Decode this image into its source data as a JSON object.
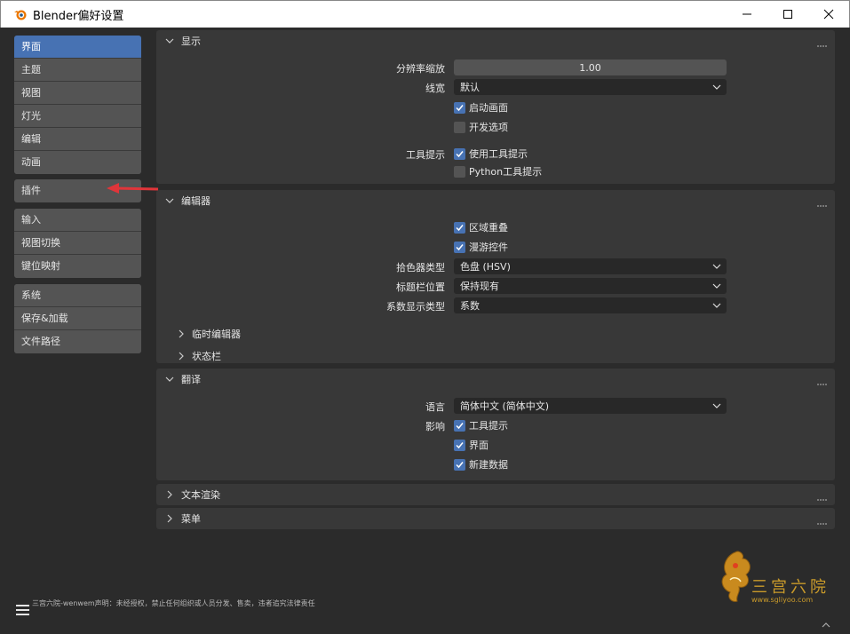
{
  "window": {
    "title": "Blender偏好设置",
    "controls": {
      "minimize": "—",
      "maximize": "☐",
      "close": "✕"
    }
  },
  "sidebar": {
    "groups": [
      {
        "items": [
          {
            "label": "界面",
            "active": true
          },
          {
            "label": "主题"
          },
          {
            "label": "视图"
          },
          {
            "label": "灯光"
          },
          {
            "label": "编辑"
          },
          {
            "label": "动画"
          }
        ]
      },
      {
        "items": [
          {
            "label": "插件"
          }
        ]
      },
      {
        "items": [
          {
            "label": "输入"
          },
          {
            "label": "视图切换"
          },
          {
            "label": "键位映射"
          }
        ]
      },
      {
        "items": [
          {
            "label": "系统"
          },
          {
            "label": "保存&加载"
          },
          {
            "label": "文件路径"
          }
        ]
      }
    ],
    "footer_note": "三宫六院-wenwem声明：未经授权，禁止任何组织或人员分发、售卖，违者追究法律责任"
  },
  "panels": {
    "display": {
      "title": "显示",
      "resolution_scale_label": "分辨率缩放",
      "resolution_scale_value": "1.00",
      "line_width_label": "线宽",
      "line_width_value": "默认",
      "splash_label": "启动画面",
      "splash_checked": true,
      "dev_extras_label": "开发选项",
      "dev_extras_checked": false,
      "tooltips_label": "工具提示",
      "use_tooltips_label": "使用工具提示",
      "use_tooltips_checked": true,
      "python_tooltips_label": "Python工具提示",
      "python_tooltips_checked": false
    },
    "editors": {
      "title": "编辑器",
      "region_overlap_label": "区域重叠",
      "region_overlap_checked": true,
      "navigation_controls_label": "漫游控件",
      "navigation_controls_checked": true,
      "color_picker_label": "拾色器类型",
      "color_picker_value": "色盘 (HSV)",
      "header_position_label": "标题栏位置",
      "header_position_value": "保持现有",
      "factor_display_label": "系数显示类型",
      "factor_display_value": "系数",
      "temp_editors_label": "临时编辑器",
      "status_bar_label": "状态栏"
    },
    "translation": {
      "title": "翻译",
      "language_label": "语言",
      "language_value": "简体中文 (简体中文)",
      "affect_label": "影响",
      "tooltips_label": "工具提示",
      "tooltips_checked": true,
      "interface_label": "界面",
      "interface_checked": true,
      "new_data_label": "新建数据",
      "new_data_checked": true
    },
    "text_rendering": {
      "title": "文本渲染"
    },
    "menus": {
      "title": "菜单"
    }
  },
  "watermark": {
    "chars": "三宫六院",
    "url": "www.sgliyoo.com"
  },
  "colors": {
    "accent": "#4772b3",
    "arrow": "#e0353a"
  }
}
